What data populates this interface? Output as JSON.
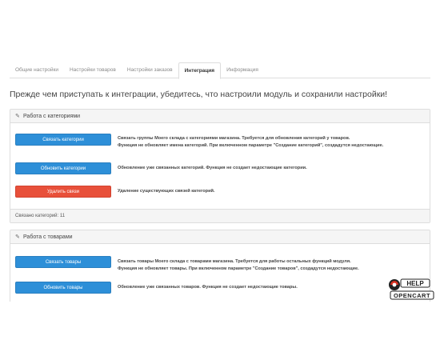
{
  "tabs": [
    {
      "label": "Общие настройки",
      "active": false
    },
    {
      "label": "Настройки товаров",
      "active": false
    },
    {
      "label": "Настройки заказов",
      "active": false
    },
    {
      "label": "Интеграция",
      "active": true
    },
    {
      "label": "Информация",
      "active": false
    }
  ],
  "heading": "Прежде чем приступать к интеграции, убедитесь, что настроили модуль и сохранили настройки!",
  "categories_panel": {
    "title": "Работа с категориями",
    "link_button": "Связать категории",
    "link_desc_line1": "Связать группы Моего склада с категориями магазина. Требуется для обновления категорий у товаров.",
    "link_desc_line2": "Функция не обновляет имена категорий. При включенном параметре \"Создание категорий\", создадутся недостающие.",
    "update_button": "Обновить категории",
    "update_desc": "Обновление уже связанных категорий. Функция не создает недостающие категории.",
    "delete_button": "Удалить связи",
    "delete_desc": "Удаление существующих связей категорий.",
    "footer": "Связано категорий: 11"
  },
  "products_panel": {
    "title": "Работа с товарами",
    "link_button": "Связать товары",
    "link_desc_line1": "Связать товары Моего склада с товарами магазина. Требуется для работы остальных функций модуля.",
    "link_desc_line2": "Функция не обновляет товары. При включенном параметре \"Создание товаров\", создадутся недостающие.",
    "update_button": "Обновить товары",
    "update_desc": "Обновление уже связанных товаров. Функция не создает недостающие товары."
  },
  "logo": {
    "top": "HELP",
    "bottom": "OPENCART"
  },
  "colors": {
    "primary_button": "#2d8fd8",
    "danger_button": "#e8503a",
    "panel_header": "#f5f5f5"
  }
}
